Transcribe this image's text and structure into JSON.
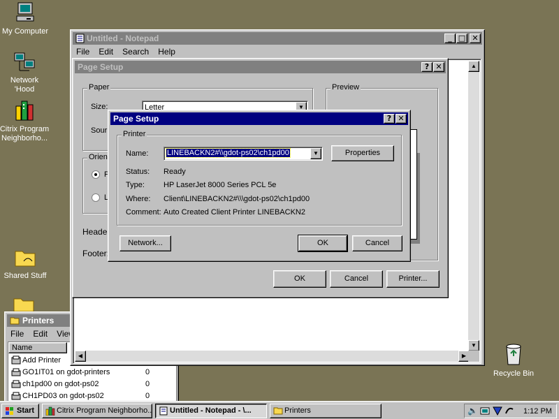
{
  "desktop": {
    "icons": [
      {
        "label": "My Computer"
      },
      {
        "label": "Network 'Hood"
      },
      {
        "label": "Citrix Program Neighborho..."
      },
      {
        "label": "Shared Stuff"
      },
      {
        "label": "Recycle Bin"
      }
    ]
  },
  "notepad": {
    "title": "Untitled - Notepad",
    "menu": [
      "File",
      "Edit",
      "Search",
      "Help"
    ]
  },
  "page_setup_back": {
    "title": "Page Setup",
    "paper_group": "Paper",
    "size_label": "Size:",
    "size_value": "Letter",
    "source_label": "Sour",
    "preview_group": "Preview",
    "orientation_group": "Orient",
    "portrait_short": "P",
    "landscape_short": "L",
    "header_label": "Header",
    "footer_label": "Footer:",
    "ok": "OK",
    "cancel": "Cancel",
    "printer": "Printer..."
  },
  "page_setup_front": {
    "title": "Page Setup",
    "printer_group": "Printer",
    "name_label": "Name:",
    "name_value": "LINEBACKN2#\\\\gdot-ps02\\ch1pd00",
    "properties": "Properties",
    "status_label": "Status:",
    "status_value": "Ready",
    "type_label": "Type:",
    "type_value": "HP LaserJet 8000 Series PCL 5e",
    "where_label": "Where:",
    "where_value": "Client\\LINEBACKN2#\\\\\\gdot-ps02\\ch1pd00",
    "comment_label": "Comment:",
    "comment_value": "Auto Created Client Printer LINEBACKN2",
    "network": "Network...",
    "ok": "OK",
    "cancel": "Cancel"
  },
  "printers_window": {
    "title": "Printers",
    "menu": [
      "File",
      "Edit",
      "View"
    ],
    "column_name": "Name",
    "rows": [
      {
        "name": "Add Printer",
        "count": ""
      },
      {
        "name": "GO1IT01 on gdot-printers",
        "count": "0"
      },
      {
        "name": "ch1pd00 on gdot-ps02",
        "count": "0"
      },
      {
        "name": "CH1PD03 on gdot-ps02",
        "count": "0"
      }
    ]
  },
  "taskbar": {
    "start": "Start",
    "tasks": [
      {
        "label": "Citrix Program Neighborho..."
      },
      {
        "label": "Untitled - Notepad - \\..."
      },
      {
        "label": "Printers"
      }
    ],
    "clock": "1:12 PM"
  }
}
